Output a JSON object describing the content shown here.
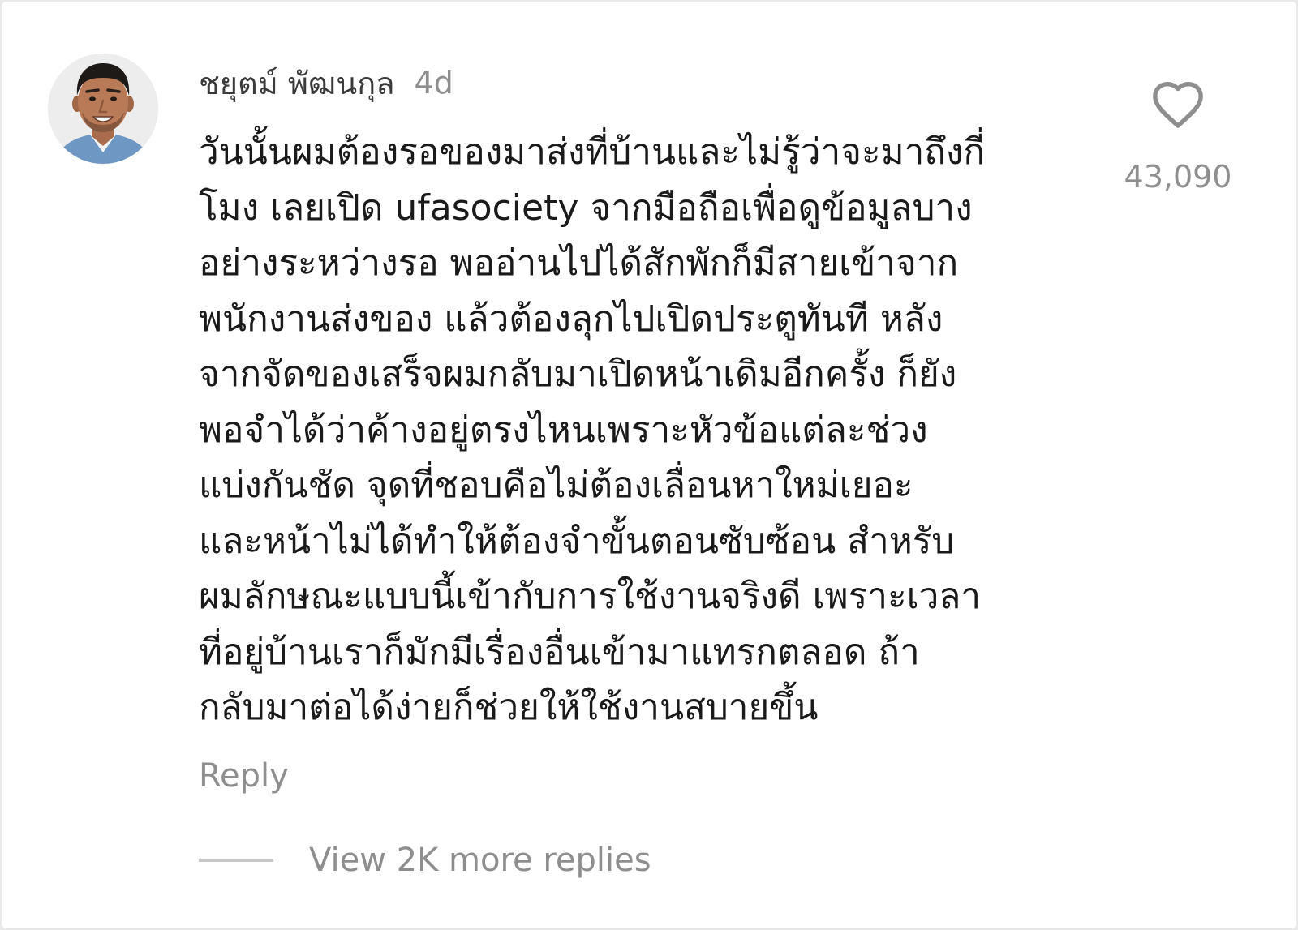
{
  "comment": {
    "username": "ชยุตม์ พัฒนกุล",
    "timestamp": "4d",
    "text_lines": [
      "วันนั้นผมต้องรอของมาส่งที่บ้านและไม่รู้ว่าจะมาถึงกี่",
      "โมง เลยเปิด ufasociety จากมือถือเพื่อดูข้อมูลบาง",
      "อย่างระหว่างรอ พออ่านไปได้สักพักก็มีสายเข้าจาก",
      "พนักงานส่งของ แล้วต้องลุกไปเปิดประตูทันที หลัง",
      "จากจัดของเสร็จผมกลับมาเปิดหน้าเดิมอีกครั้ง ก็ยัง",
      "พอจำได้ว่าค้างอยู่ตรงไหนเพราะหัวข้อแต่ละช่วง",
      "แบ่งกันชัด จุดที่ชอบคือไม่ต้องเลื่อนหาใหม่เยอะ",
      "และหน้าไม่ได้ทำให้ต้องจำขั้นตอนซับซ้อน สำหรับ",
      "ผมลักษณะแบบนี้เข้ากับการใช้งานจริงดี เพราะเวลา",
      "ที่อยู่บ้านเราก็มักมีเรื่องอื่นเข้ามาแทรกตลอด ถ้า",
      "กลับมาต่อได้ง่ายก็ช่วยให้ใช้งานสบายขึ้น"
    ],
    "like_icon": "heart-outline-icon",
    "like_count": "43,090",
    "reply_label": "Reply",
    "view_replies_label": "View 2K more replies"
  },
  "colors": {
    "text_primary": "#1a1a1a",
    "text_secondary": "#8e8e8e",
    "username": "#3a3a3a",
    "background": "#ffffff"
  }
}
